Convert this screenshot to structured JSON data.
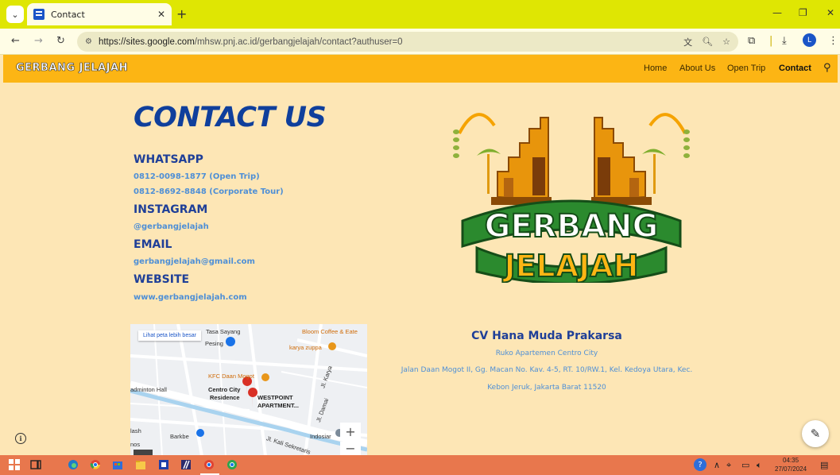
{
  "browser": {
    "tab_title": "Contact",
    "new_tab": "+",
    "url_host": "https://sites.google.com",
    "url_path": "/mhsw.pnj.ac.id/gerbangjelajah/contact?authuser=0",
    "profile_initial": "L"
  },
  "site": {
    "logo": "GERBANG JELAJAH",
    "nav": [
      "Home",
      "About Us",
      "Open Trip",
      "Contact"
    ]
  },
  "contact": {
    "title": "CONTACT US",
    "whatsapp_h": "WHATSAPP",
    "whatsapp_1": "0812-0098-1877 (Open Trip)",
    "whatsapp_2": "0812-8692-8848 (Corporate Tour)",
    "instagram_h": "INSTAGRAM",
    "instagram": "@gerbangjelajah",
    "email_h": "EMAIL",
    "email": "gerbangjelajah@gmail.com",
    "website_h": "WEBSITE",
    "website": "www.gerbangjelajah.com"
  },
  "logo_art": {
    "line1": "GERBANG",
    "line2": "JELAJAH"
  },
  "map": {
    "view_larger": "Lihat peta lebih besar",
    "labels": {
      "bloom": "Bloom Coffee & Eate",
      "pesing": "Pesing",
      "sayang": "Tasa Sayang",
      "karya": "karya zuppa",
      "kfc": "KFC Daan Mogot",
      "hall": "adminton Hall",
      "centro": "Centro City",
      "residence": "Residence",
      "westpoint": "WESTPOINT",
      "apartment": "APARTMENT...",
      "barkbe": "Barkbe",
      "lash": "lash",
      "nos": "nos",
      "indosiar": "Indosiar",
      "jl_kayu": "Jl. Karya",
      "jl_damai": "Jl. Damai",
      "jl_kali": "Jl. Kali Sekretaris"
    },
    "zoom_in": "+",
    "zoom_out": "−"
  },
  "company": {
    "name": "CV Hana Muda Prakarsa",
    "line1": "Ruko Apartemen Centro City",
    "line2": "Jalan Daan Mogot II, Gg. Macan No. Kav. 4-5, RT. 10/RW.1, Kel. Kedoya Utara, Kec.",
    "line3": "Kebon Jeruk, Jakarta Barat 11520"
  },
  "taskbar": {
    "time": "04:35",
    "date": "27/07/2024"
  },
  "colors": {
    "chrome_bar": "#dfe603",
    "header": "#fcb514",
    "page_bg": "#fde6b5",
    "heading": "#1f3f98",
    "link": "#4e8fd6",
    "taskbar": "#e8774d"
  }
}
